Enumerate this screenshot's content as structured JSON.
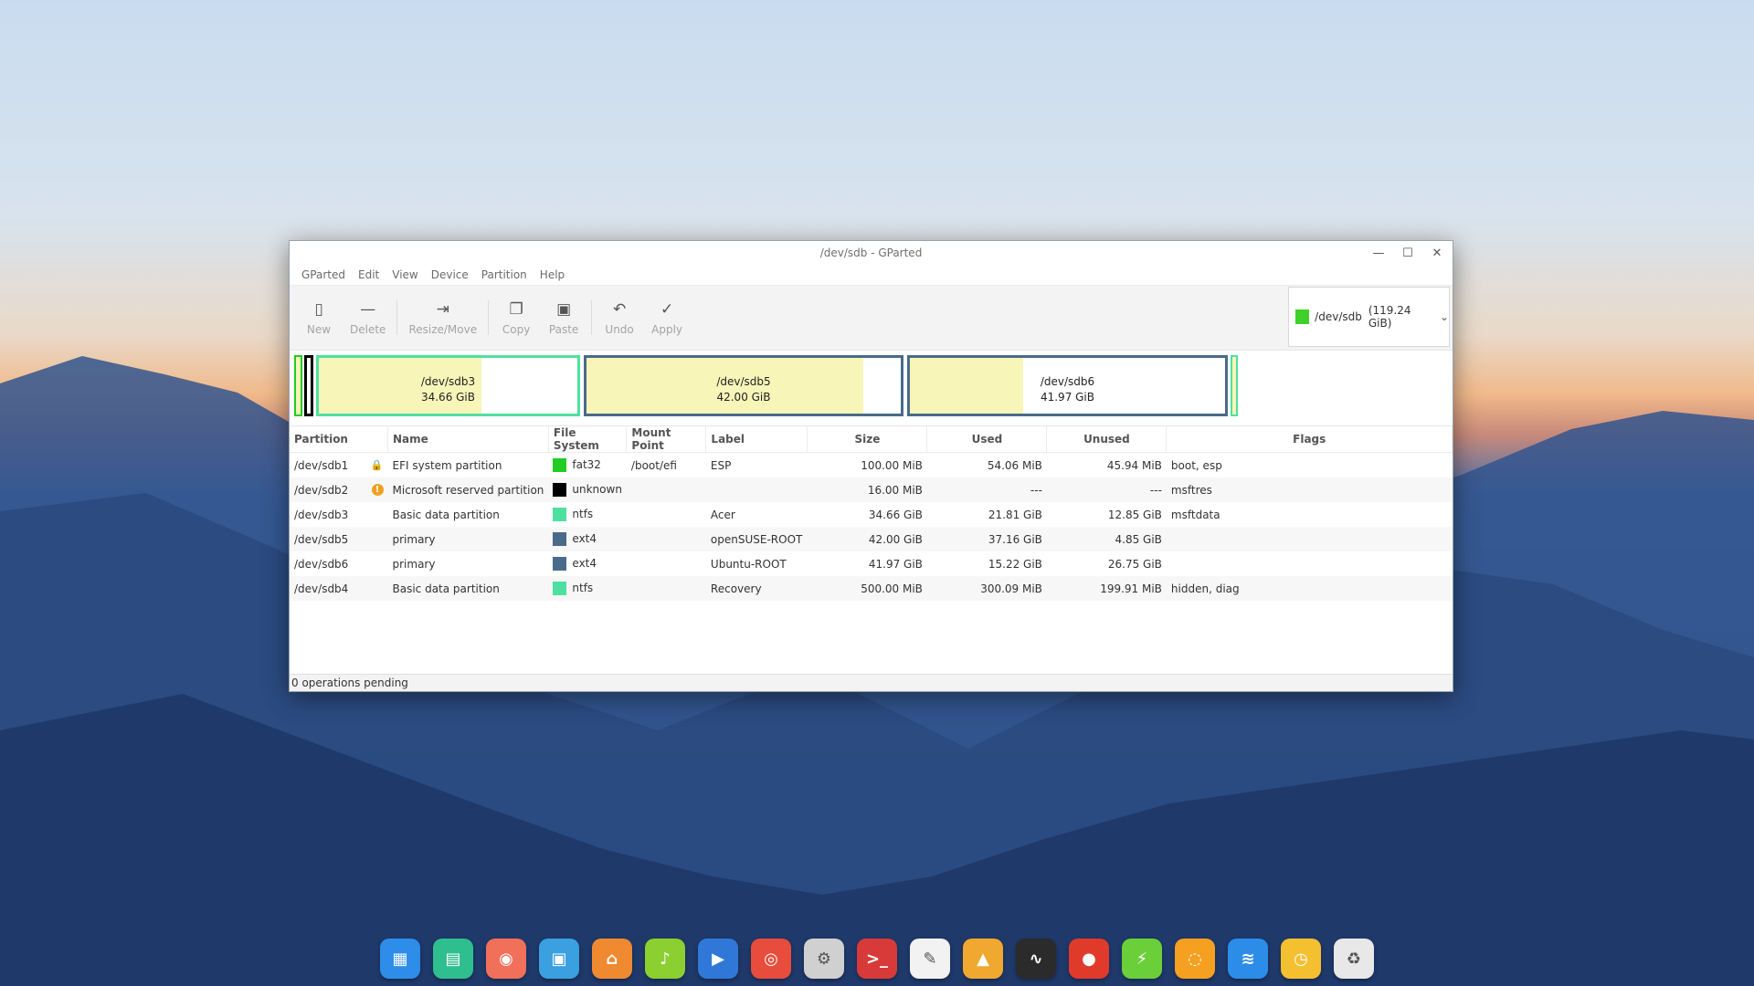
{
  "window": {
    "title": "/dev/sdb - GParted",
    "minimize_icon": "minimize-icon",
    "maximize_icon": "maximize-icon",
    "close_icon": "close-icon"
  },
  "menu": [
    "GParted",
    "Edit",
    "View",
    "Device",
    "Partition",
    "Help"
  ],
  "toolbar": {
    "new": "New",
    "delete": "Delete",
    "resize": "Resize/Move",
    "copy": "Copy",
    "paste": "Paste",
    "undo": "Undo",
    "apply": "Apply"
  },
  "device": {
    "name": "/dev/sdb",
    "size": "(119.24 GiB)",
    "color": "#3fd12a"
  },
  "diskmap": {
    "sdb3": {
      "name": "/dev/sdb3",
      "size": "34.66 GiB",
      "used_fraction": 0.63,
      "border": "#4ee0a0"
    },
    "sdb5": {
      "name": "/dev/sdb5",
      "size": "42.00 GiB",
      "used_fraction": 0.88,
      "border": "#4a6a8a"
    },
    "sdb6": {
      "name": "/dev/sdb6",
      "size": "41.97 GiB",
      "used_fraction": 0.36,
      "border": "#4a6a8a"
    }
  },
  "columns": {
    "partition": "Partition",
    "name": "Name",
    "fs": "File System",
    "mount": "Mount Point",
    "label": "Label",
    "size": "Size",
    "used": "Used",
    "unused": "Unused",
    "flags": "Flags"
  },
  "rows": [
    {
      "partition": "/dev/sdb1",
      "icon": "lock-icon",
      "name": "EFI system partition",
      "fs_color": "#22cc22",
      "fs": "fat32",
      "mount": "/boot/efi",
      "label": "ESP",
      "size": "100.00 MiB",
      "used": "54.06 MiB",
      "unused": "45.94 MiB",
      "flags": "boot, esp"
    },
    {
      "partition": "/dev/sdb2",
      "icon": "warning-icon",
      "name": "Microsoft reserved partition",
      "fs_color": "#000000",
      "fs": "unknown",
      "mount": "",
      "label": "",
      "size": "16.00 MiB",
      "used": "---",
      "unused": "---",
      "flags": "msftres"
    },
    {
      "partition": "/dev/sdb3",
      "icon": "",
      "name": "Basic data partition",
      "fs_color": "#4ee0a0",
      "fs": "ntfs",
      "mount": "",
      "label": "Acer",
      "size": "34.66 GiB",
      "used": "21.81 GiB",
      "unused": "12.85 GiB",
      "flags": "msftdata"
    },
    {
      "partition": "/dev/sdb5",
      "icon": "",
      "name": "primary",
      "fs_color": "#4a6a8a",
      "fs": "ext4",
      "mount": "",
      "label": "openSUSE-ROOT",
      "size": "42.00 GiB",
      "used": "37.16 GiB",
      "unused": "4.85 GiB",
      "flags": ""
    },
    {
      "partition": "/dev/sdb6",
      "icon": "",
      "name": "primary",
      "fs_color": "#4a6a8a",
      "fs": "ext4",
      "mount": "",
      "label": "Ubuntu-ROOT",
      "size": "41.97 GiB",
      "used": "15.22 GiB",
      "unused": "26.75 GiB",
      "flags": ""
    },
    {
      "partition": "/dev/sdb4",
      "icon": "",
      "name": "Basic data partition",
      "fs_color": "#4ee0a0",
      "fs": "ntfs",
      "mount": "",
      "label": "Recovery",
      "size": "500.00 MiB",
      "used": "300.09 MiB",
      "unused": "199.91 MiB",
      "flags": "hidden, diag"
    }
  ],
  "status": "0 operations pending",
  "dock": [
    {
      "icon": "launcher-icon",
      "color": "#2e8de8",
      "glyph": "▦"
    },
    {
      "icon": "file-manager-icon",
      "color": "#2fbf8f",
      "glyph": "▤"
    },
    {
      "icon": "screen-recorder-icon",
      "color": "#f0705a",
      "glyph": "◉"
    },
    {
      "icon": "store-icon",
      "color": "#3aa0e0",
      "glyph": "▣"
    },
    {
      "icon": "app-store-icon",
      "color": "#f08a30",
      "glyph": "⌂"
    },
    {
      "icon": "music-icon",
      "color": "#8ccf30",
      "glyph": "♪"
    },
    {
      "icon": "video-icon",
      "color": "#2f78d8",
      "glyph": "▶"
    },
    {
      "icon": "chrome-icon",
      "color": "#e74c3c",
      "glyph": "◎"
    },
    {
      "icon": "settings-icon",
      "color": "#d0d0d0",
      "glyph": "⚙"
    },
    {
      "icon": "terminal-icon",
      "color": "#d83a3a",
      "glyph": ">_"
    },
    {
      "icon": "text-editor-icon",
      "color": "#f2f2f2",
      "glyph": "✎"
    },
    {
      "icon": "image-viewer-icon",
      "color": "#f0a830",
      "glyph": "▲"
    },
    {
      "icon": "system-monitor-icon",
      "color": "#2b2b2b",
      "glyph": "∿"
    },
    {
      "icon": "browser-icon",
      "color": "#e03a2a",
      "glyph": "●"
    },
    {
      "icon": "power-icon",
      "color": "#6bcf3a",
      "glyph": "⚡"
    },
    {
      "icon": "sync-icon",
      "color": "#f5a020",
      "glyph": "◌"
    },
    {
      "icon": "wifi-icon",
      "color": "#2c8de8",
      "glyph": "≋"
    },
    {
      "icon": "clock-icon",
      "color": "#f5c030",
      "glyph": "◷"
    },
    {
      "icon": "trash-icon",
      "color": "#e8e8e8",
      "glyph": "♻"
    }
  ]
}
